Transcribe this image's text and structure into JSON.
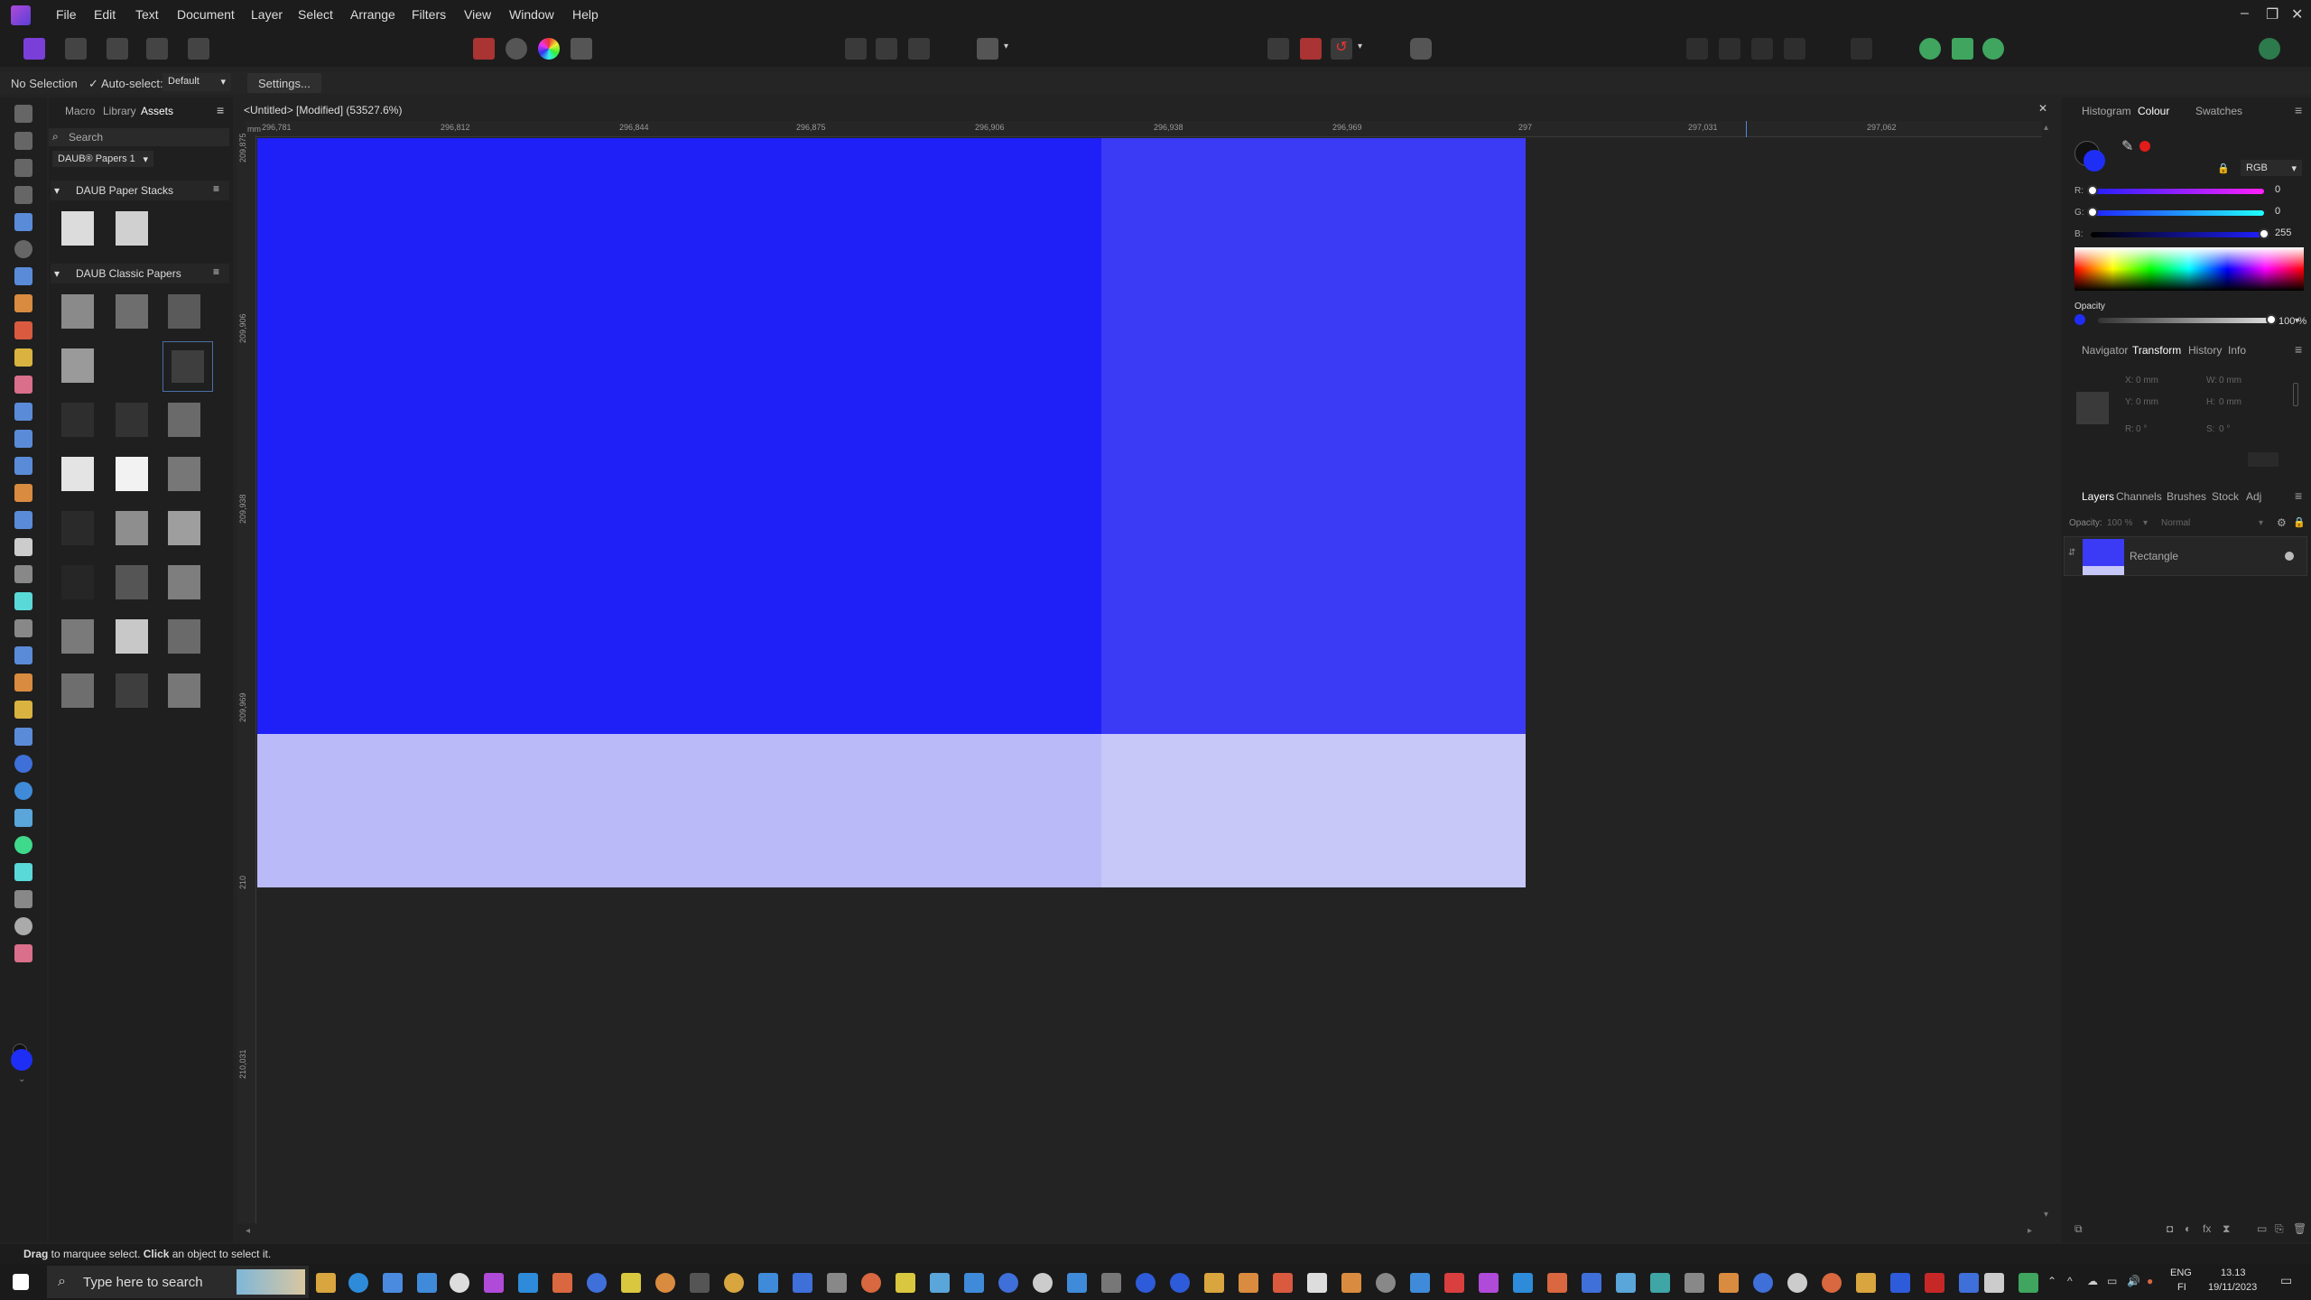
{
  "menu": [
    "File",
    "Edit",
    "Text",
    "Document",
    "Layer",
    "Select",
    "Arrange",
    "Filters",
    "View",
    "Window",
    "Help"
  ],
  "context": {
    "selection": "No Selection",
    "autoselect_label": "Auto-select:",
    "autoselect_value": "Default",
    "settings": "Settings..."
  },
  "left_panel": {
    "tabs": [
      "Macro",
      "Library",
      "Assets"
    ],
    "active_tab": "Assets",
    "search_placeholder": "Search",
    "category": "DAUB® Papers 1",
    "sections": [
      {
        "title": "DAUB Paper Stacks"
      },
      {
        "title": "DAUB Classic Papers"
      }
    ]
  },
  "document": {
    "title": "<Untitled> [Modified] (53527.6%)"
  },
  "ruler": {
    "unit": "mm",
    "h_labels": [
      "296,781",
      "296,812",
      "296,844",
      "296,875",
      "296,906",
      "296,938",
      "296,969",
      "297",
      "297,031",
      "297,062"
    ],
    "v_labels": [
      "209,875",
      "209,906",
      "209,938",
      "209,969",
      "210",
      "210,031"
    ]
  },
  "right_panel": {
    "color_tabs": [
      "Histogram",
      "Colour",
      "Swatches"
    ],
    "active_color_tab": "Colour",
    "color_mode": "RGB",
    "channels": [
      {
        "label": "R:",
        "value": "0"
      },
      {
        "label": "G:",
        "value": "0"
      },
      {
        "label": "B:",
        "value": "255"
      }
    ],
    "opacity_label": "Opacity",
    "opacity_value": "100 %",
    "transform_tabs": [
      "Navigator",
      "Transform",
      "History",
      "Info"
    ],
    "active_transform_tab": "Transform",
    "transform": {
      "x_label": "X:",
      "x": "0 mm",
      "y_label": "Y:",
      "y": "0 mm",
      "w_label": "W:",
      "w": "0 mm",
      "h_label": "H:",
      "h": "0 mm",
      "r_label": "R:",
      "r": "0 °",
      "s_label": "S:",
      "s": "0 °"
    },
    "layer_tabs": [
      "Layers",
      "Channels",
      "Brushes",
      "Stock",
      "Adj"
    ],
    "active_layer_tab": "Layers",
    "layer_opacity_label": "Opacity:",
    "layer_opacity": "100 %",
    "blend_mode": "Normal",
    "layers": [
      {
        "name": "Rectangle"
      }
    ]
  },
  "status": {
    "drag": "Drag",
    "text1": " to marquee select. ",
    "click": "Click",
    "text2": " an object to select it."
  },
  "taskbar": {
    "search_placeholder": "Type here to search",
    "lang": "ENG",
    "region": "FI",
    "time": "13.13",
    "date": "19/11/2023"
  },
  "colors": {
    "canvas_blue_left": "#1f1ff8",
    "canvas_blue_right": "#3b3bf5",
    "canvas_light_left": "#babaf8",
    "canvas_light_right": "#c7c7f8",
    "accent": "#1f2ef5"
  }
}
